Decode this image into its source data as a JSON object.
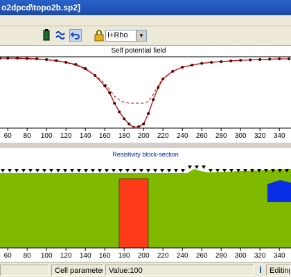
{
  "window": {
    "title": "o2dpcd\\topo2b.sp2]"
  },
  "toolbar": {
    "combo_value": "I+Rho",
    "icons": [
      "battery-icon",
      "waves-icon",
      "undo-icon",
      "lock-icon"
    ]
  },
  "top_chart": {
    "title": "Self potential field",
    "x_ticks": [
      "60",
      "80",
      "100",
      "120",
      "140",
      "160",
      "180",
      "200",
      "220",
      "240",
      "260",
      "280",
      "300",
      "320",
      "340"
    ]
  },
  "bottom_chart": {
    "title": "Resistivity block-section",
    "x_ticks": [
      "60",
      "80",
      "100",
      "120",
      "140",
      "160",
      "180",
      "200",
      "220",
      "240",
      "260",
      "280",
      "300",
      "320",
      "340"
    ],
    "colors": {
      "background": "#7fba00",
      "anomaly": "#ff3b1a",
      "block": "#0a2ee6"
    }
  },
  "status": {
    "cell_params_label": "Cell parameters",
    "value_label": "Value:100",
    "info_icon": "info-icon",
    "mode_label": "Editing"
  },
  "chart_data": {
    "type": "line",
    "title": "Self potential field",
    "x": [
      52,
      60,
      70,
      80,
      90,
      100,
      110,
      120,
      130,
      140,
      150,
      160,
      165,
      170,
      175,
      180,
      185,
      190,
      195,
      200,
      205,
      210,
      215,
      220,
      230,
      240,
      250,
      260,
      270,
      280,
      290,
      300,
      310,
      320,
      330,
      340,
      350
    ],
    "series": [
      {
        "name": "",
        "style": "observed points",
        "values": [
          1.0,
          1.0,
          1.0,
          0.99,
          0.98,
          0.96,
          0.93,
          0.88,
          0.82,
          0.7,
          0.5,
          0.2,
          0.0,
          -0.3,
          -0.55,
          -0.75,
          -0.9,
          -1.0,
          -0.98,
          -0.9,
          -0.6,
          -0.2,
          0.15,
          0.4,
          0.62,
          0.74,
          0.8,
          0.85,
          0.88,
          0.9,
          0.92,
          0.94,
          0.95,
          0.96,
          0.97,
          0.98,
          0.98
        ]
      },
      {
        "name": "",
        "style": "dashed",
        "values": [
          1.0,
          1.0,
          0.99,
          0.98,
          0.97,
          0.95,
          0.92,
          0.87,
          0.8,
          0.68,
          0.5,
          0.28,
          0.1,
          -0.1,
          -0.2,
          -0.28,
          -0.3,
          -0.3,
          -0.3,
          -0.3,
          -0.25,
          -0.05,
          0.2,
          0.42,
          0.62,
          0.74,
          0.8,
          0.85,
          0.88,
          0.9,
          0.92,
          0.94,
          0.95,
          0.96,
          0.97,
          0.98,
          0.98
        ]
      }
    ],
    "xlim": [
      52,
      352
    ],
    "grid": false
  }
}
